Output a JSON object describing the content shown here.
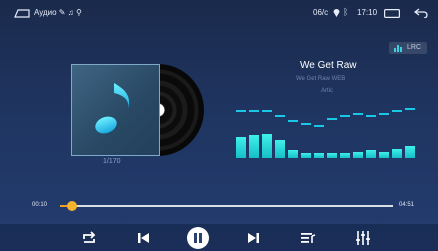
{
  "status_bar": {
    "app_label": "Аудио ✎ ♫ ⚲",
    "speed": "06/с",
    "time": "17:10"
  },
  "player": {
    "track_index": "1/170",
    "title": "We Get Raw",
    "album": "We Get Raw WEB",
    "artist": "Artic",
    "lrc_label": "LRC",
    "current_time": "00:10",
    "total_time": "04:51",
    "progress_fraction": 0.035
  },
  "visualizer": {
    "bar_levels": [
      0.7,
      0.75,
      0.8,
      0.6,
      0.25,
      0.15,
      0.15,
      0.15,
      0.15,
      0.2,
      0.25,
      0.2,
      0.3,
      0.4
    ],
    "peak_levels": [
      0.95,
      0.95,
      0.95,
      0.85,
      0.75,
      0.7,
      0.65,
      0.8,
      0.85,
      0.9,
      0.85,
      0.9,
      0.95,
      1.0
    ]
  },
  "colors": {
    "accent": "#f7b52b",
    "bar": "#27d9dd"
  },
  "controls": [
    "repeat-icon",
    "previous-icon",
    "pause-icon",
    "next-icon",
    "playlist-icon",
    "equalizer-icon"
  ]
}
